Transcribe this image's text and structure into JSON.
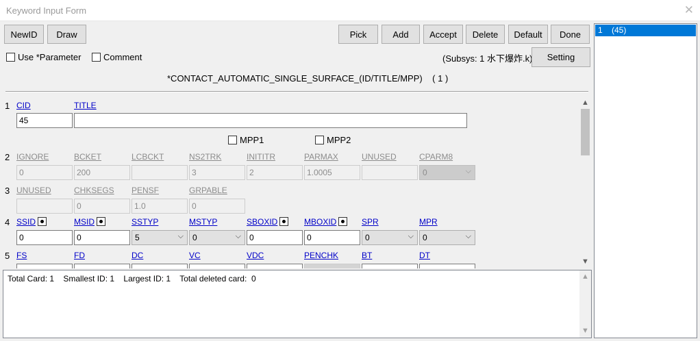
{
  "window": {
    "title": "Keyword Input Form",
    "close_glyph": "✕"
  },
  "toolbar": {
    "newid": "NewID",
    "draw": "Draw",
    "pick": "Pick",
    "add": "Add",
    "accept": "Accept",
    "delete": "Delete",
    "default": "Default",
    "done": "Done"
  },
  "options": {
    "use_parameter": "Use *Parameter",
    "use_parameter_checked": false,
    "comment": "Comment",
    "comment_checked": false,
    "subsys": "(Subsys: 1 水下爆炸.k)",
    "setting": "Setting"
  },
  "keyword": {
    "title": "*CONTACT_AUTOMATIC_SINGLE_SURFACE_(ID/TITLE/MPP)    ( 1 )"
  },
  "card1": {
    "num": "1",
    "cid_label": "CID",
    "title_label": "TITLE",
    "cid_value": "45",
    "title_value": ""
  },
  "mpp": {
    "mpp1": "MPP1",
    "mpp2": "MPP2"
  },
  "card2": {
    "num": "2",
    "labels": [
      "IGNORE",
      "BCKET",
      "LCBCKT",
      "NS2TRK",
      "INITITR",
      "PARMAX",
      "UNUSED",
      "CPARM8"
    ],
    "values": [
      "0",
      "200",
      "",
      "3",
      "2",
      "1.0005",
      "",
      "0"
    ]
  },
  "card3": {
    "num": "3",
    "labels": [
      "UNUSED",
      "CHKSEGS",
      "PENSF",
      "GRPABLE"
    ],
    "values": [
      "",
      "0",
      "1.0",
      "0"
    ]
  },
  "card4": {
    "num": "4",
    "labels": [
      "SSID",
      "MSID",
      "SSTYP",
      "MSTYP",
      "SBOXID",
      "MBOXID",
      "SPR",
      "MPR"
    ],
    "values": [
      "0",
      "0",
      "5",
      "0",
      "0",
      "0",
      "0",
      "0"
    ]
  },
  "card5": {
    "num": "5",
    "labels": [
      "FS",
      "FD",
      "DC",
      "VC",
      "VDC",
      "PENCHK",
      "BT",
      "DT"
    ]
  },
  "scroll": {
    "up": "▲",
    "down": "▼",
    "caret": "⌵"
  },
  "info": {
    "text": "Total Card: 1    Smallest ID: 1    Largest ID: 1    Total deleted card:  0"
  },
  "idlist": {
    "items": [
      "1    (45)"
    ]
  },
  "colors": {
    "selection": "#0078d7",
    "link": "#0000c8",
    "disabled": "#8c8c8c"
  },
  "icons": [
    "close-icon",
    "checkbox",
    "dropdown-caret-icon",
    "scroll-up-icon",
    "scroll-down-icon",
    "pick-dot-icon"
  ]
}
